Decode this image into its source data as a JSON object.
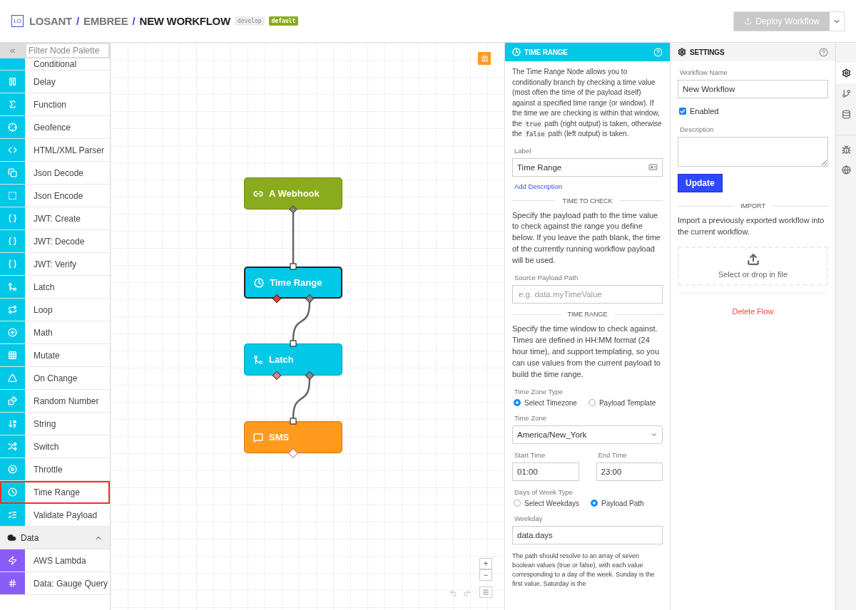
{
  "header": {
    "logo": "LO",
    "breadcrumbs": [
      "LOSANT",
      "EMBREE",
      "NEW WORKFLOW"
    ],
    "separators": [
      "/",
      "/"
    ],
    "badges": [
      {
        "text": "develop",
        "kind": "branch"
      },
      {
        "text": "default",
        "kind": "tag"
      }
    ],
    "deploy_button": "Deploy Workflow"
  },
  "palette": {
    "filter_placeholder": "Filter Node Palette",
    "logic_items": [
      {
        "label": "Conditional",
        "selected": false
      },
      {
        "label": "Delay",
        "selected": false
      },
      {
        "label": "Function",
        "selected": false
      },
      {
        "label": "Geofence",
        "selected": false
      },
      {
        "label": "HTML/XML Parser",
        "selected": false
      },
      {
        "label": "Json Decode",
        "selected": false
      },
      {
        "label": "Json Encode",
        "selected": false
      },
      {
        "label": "JWT: Create",
        "selected": false
      },
      {
        "label": "JWT: Decode",
        "selected": false
      },
      {
        "label": "JWT: Verify",
        "selected": false
      },
      {
        "label": "Latch",
        "selected": false
      },
      {
        "label": "Loop",
        "selected": false
      },
      {
        "label": "Math",
        "selected": false
      },
      {
        "label": "Mutate",
        "selected": false
      },
      {
        "label": "On Change",
        "selected": false
      },
      {
        "label": "Random Number",
        "selected": false
      },
      {
        "label": "String",
        "selected": false
      },
      {
        "label": "Switch",
        "selected": false
      },
      {
        "label": "Throttle",
        "selected": false
      },
      {
        "label": "Time Range",
        "selected": true
      },
      {
        "label": "Validate Payload",
        "selected": false
      }
    ],
    "data_group": {
      "label": "Data",
      "expanded": true,
      "items": [
        {
          "label": "AWS Lambda",
          "selected": false
        },
        {
          "label": "Data: Gauge Query",
          "selected": false
        }
      ]
    }
  },
  "canvas": {
    "nodes": [
      {
        "label": "A Webhook",
        "kind": "trigger",
        "color": "#8aab1e",
        "selected": false
      },
      {
        "label": "Time Range",
        "kind": "branch",
        "color": "#00c8e6",
        "selected": true
      },
      {
        "label": "Latch",
        "kind": "branch",
        "color": "#00c8e6",
        "selected": false
      },
      {
        "label": "SMS",
        "kind": "output",
        "color": "#ff9a1f",
        "selected": false
      }
    ],
    "zoom_in": "+",
    "zoom_out": "−"
  },
  "node_panel": {
    "title": "TIME RANGE",
    "description": [
      {
        "kind": "text",
        "text": "The Time Range Node allows you to conditionally branch by checking a time value (most often the time of the payload itself) against a specified time range (or window). If the time we are checking is within that window, the "
      },
      {
        "kind": "code",
        "text": "true"
      },
      {
        "kind": "text",
        "text": " path (right output) is taken, otherwise the "
      },
      {
        "kind": "code",
        "text": "false"
      },
      {
        "kind": "text",
        "text": " path (left output) is taken."
      }
    ],
    "label_field": {
      "label": "Label",
      "value": "Time Range"
    },
    "add_description": "Add Description",
    "time_to_check": {
      "heading": "TIME TO CHECK",
      "text": "Specify the payload path to the time value to check against the range you define below. If you leave the path blank, the time of the currently running workflow payload will be used.",
      "path_field": {
        "label": "Source Payload Path",
        "placeholder": "e.g. data.myTimeValue"
      }
    },
    "time_range": {
      "heading": "TIME RANGE",
      "text": "Specify the time window to check against. Times are defined in HH:MM format (24 hour time), and support templating, so you can use values from the current payload to build the time range.",
      "tz_type": {
        "label": "Time Zone Type",
        "options": [
          {
            "label": "Select Timezone",
            "selected": true
          },
          {
            "label": "Payload Template",
            "selected": false
          }
        ]
      },
      "time_zone": {
        "label": "Time Zone",
        "value": "America/New_York"
      },
      "start": {
        "label": "Start Time",
        "value": "01:00"
      },
      "end": {
        "label": "End Time",
        "value": "23:00"
      },
      "days_type": {
        "label": "Days of Week Type",
        "options": [
          {
            "label": "Select Weekdays",
            "selected": false
          },
          {
            "label": "Payload Path",
            "selected": true
          }
        ]
      },
      "weekday": {
        "label": "Weekday",
        "value": "data.days"
      },
      "note": "The path should resolve to an array of seven boolean values (true or false), with each value corresponding to a day of the week. Sunday is the first value, Saturday is the"
    }
  },
  "settings_panel": {
    "title": "SETTINGS",
    "name_field": {
      "label": "Workflow Name",
      "value": "New Workflow"
    },
    "enabled": {
      "label": "Enabled",
      "checked": true
    },
    "description_field": {
      "label": "Description"
    },
    "update_button": "Update",
    "import": {
      "heading": "IMPORT",
      "text": "Import a previously exported workflow into the current workflow.",
      "drop": "Select or drop in file"
    },
    "delete": "Delete Flow"
  },
  "side_tabs": [
    {
      "selected": true
    },
    {
      "selected": false
    },
    {
      "selected": false
    },
    {
      "selected": false
    },
    {
      "selected": false
    }
  ]
}
